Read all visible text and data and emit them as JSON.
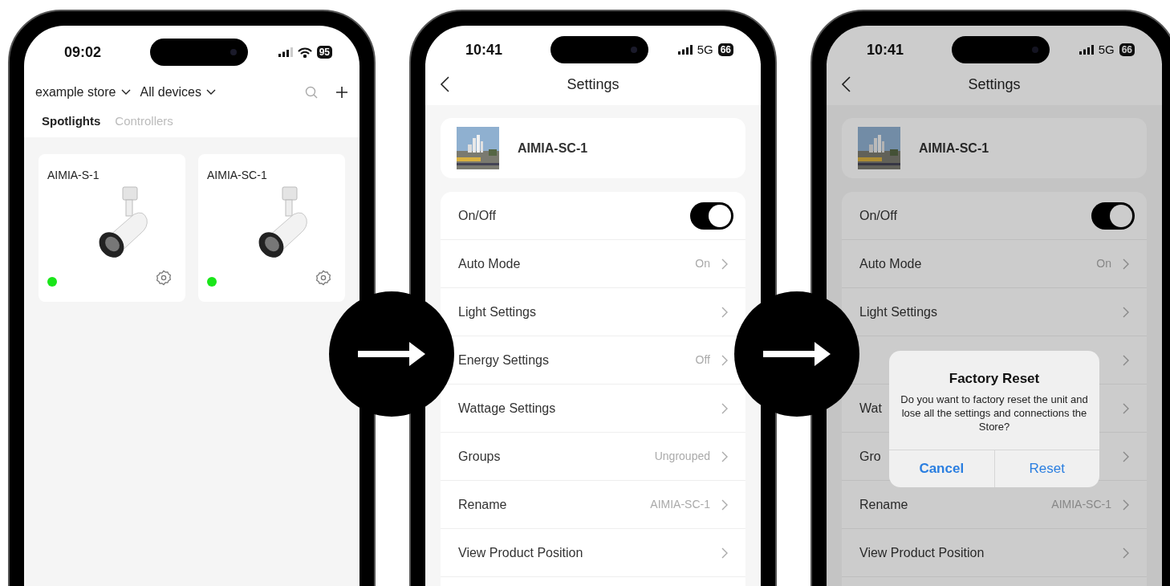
{
  "screens": [
    {
      "kind": "home",
      "status": {
        "time": "09:02",
        "network": {
          "kind": "wifi"
        },
        "battery": "95"
      },
      "store_picker": "example store",
      "device_filter": "All devices",
      "tabs": [
        {
          "label": "Spotlights",
          "selected": true
        },
        {
          "label": "Controllers",
          "selected": false
        }
      ],
      "devices": [
        {
          "name": "AIMIA-S-1",
          "color": "#19e619"
        },
        {
          "name": "AIMIA-SC-1",
          "color": "#19e619"
        }
      ]
    },
    {
      "kind": "settings",
      "status": {
        "time": "10:41",
        "network": {
          "kind": "cellular",
          "label": "5G"
        },
        "battery": "66"
      },
      "title": "Settings",
      "device": {
        "name": "AIMIA-SC-1"
      },
      "rows": [
        {
          "kind": "toggle",
          "label": "On/Off",
          "on": true
        },
        {
          "kind": "link",
          "label": "Auto Mode",
          "value": "On"
        },
        {
          "kind": "link",
          "label": "Light Settings"
        },
        {
          "kind": "link",
          "label": "Energy Settings",
          "value": "Off"
        },
        {
          "kind": "link",
          "label": "Wattage Settings"
        },
        {
          "kind": "link",
          "label": "Groups",
          "value": "Ungrouped"
        },
        {
          "kind": "link",
          "label": "Rename",
          "value": "AIMIA-SC-1"
        },
        {
          "kind": "link",
          "label": "View Product Position"
        }
      ]
    },
    {
      "kind": "settings",
      "status": {
        "time": "10:41",
        "network": {
          "kind": "cellular",
          "label": "5G"
        },
        "battery": "66"
      },
      "title": "Settings",
      "device": {
        "name": "AIMIA-SC-1"
      },
      "rows": [
        {
          "kind": "toggle",
          "label": "On/Off",
          "on": true
        },
        {
          "kind": "link",
          "label": "Auto Mode",
          "value": "On"
        },
        {
          "kind": "link",
          "label": "Light Settings"
        },
        {
          "kind": "link"
        },
        {
          "kind": "link",
          "label": "Wat"
        },
        {
          "kind": "link",
          "label": "Gro"
        },
        {
          "kind": "link",
          "label": "Rename",
          "value": "AIMIA-SC-1"
        },
        {
          "kind": "link",
          "label": "View Product Position"
        }
      ],
      "dialog": {
        "title": "Factory Reset",
        "message": "Do you want to factory reset the unit and lose all the settings and connections the Store?",
        "buttons": [
          {
            "label": "Cancel",
            "kind": "cancel"
          },
          {
            "label": "Reset",
            "kind": "confirm"
          }
        ]
      }
    }
  ]
}
